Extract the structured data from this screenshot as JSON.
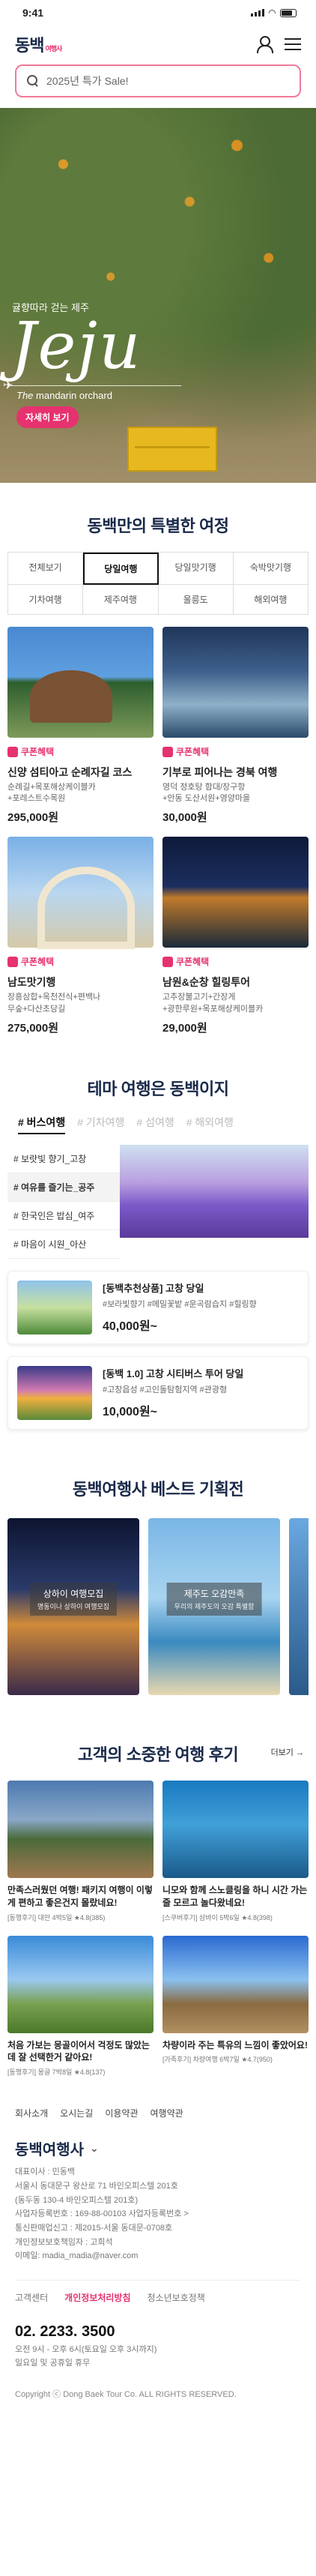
{
  "status": {
    "time": "9:41"
  },
  "header": {
    "logo": "동백",
    "logo_sub": "여행사"
  },
  "search": {
    "placeholder": "2025년 특가 Sale!"
  },
  "hero": {
    "subtitle": "귤향따라 걷는 제주",
    "title": "Jeju",
    "caption_prefix": "The",
    "caption_main": "mandarin orchard",
    "button": "자세히 보기"
  },
  "special": {
    "title": "동백만의 특별한 여정",
    "tabs": [
      "전체보기",
      "당일여행",
      "당일맛기행",
      "숙박맛기행",
      "기차여행",
      "제주여행",
      "울릉도",
      "해외여행"
    ],
    "active_tab": 1,
    "coupon_label": "쿠폰혜택",
    "cards": [
      {
        "title": "신양 섬티아고 순례자길 코스",
        "tags": "순례길+목포해상케이블카\n+포레스트수목원",
        "price": "295,000원"
      },
      {
        "title": "기부로 피어나는 경북 여행",
        "tags": "영덕 정호탕 함대/장구항\n+안동 도산서원+영양마을",
        "price": "30,000원"
      },
      {
        "title": "남도맛기행",
        "tags": "장흥삼합+옥천전식+편백나\n무숲+다산초당길",
        "price": "275,000원"
      },
      {
        "title": "남원&순창 힐링투어",
        "tags": "고추장불고기+간장게\n+광한루원+목포해상케이블카",
        "price": "29,000원"
      }
    ]
  },
  "theme": {
    "title": "테마 여행은 동백이지",
    "tabs": [
      "# 버스여행",
      "# 기차여행",
      "# 섬여행",
      "# 해외여행"
    ],
    "list": [
      "# 보랏빛 향기_고창",
      "# 여유를 즐기는_공주",
      "# 한국인은 밥심_여주",
      "# 마음이 시원_아산"
    ],
    "items": [
      {
        "title": "[동백추천상품] 고창 당일",
        "tags": "#보라빛향기 #메밀꽃밭 #운곡람습지 #힐링향",
        "price": "40,000원~"
      },
      {
        "title": "[동백 1.0] 고창 시티버스 투어 당일",
        "tags": "#고창읍성 #고인돌탐험지역 #관광형",
        "price": "10,000원~"
      }
    ]
  },
  "best": {
    "title": "동백여행사 베스트 기획전",
    "cards": [
      {
        "label": "상하이 여행모집",
        "sub": "명동이나 상하이 여행모집"
      },
      {
        "label": "제주도 오감만족",
        "sub": "우리의 제주도의 오감 특별함"
      }
    ]
  },
  "reviews": {
    "title": "고객의 소중한 여행 후기",
    "more": "더보기",
    "items": [
      {
        "text": "만족스러웠던 여행! 패키지 여행이 이렇게 편하고 좋은건지 몰랐네요!",
        "meta": "[동행후기] 대만 4박5일 ★4.8(385)"
      },
      {
        "text": "니모와 함께 스노클링을 하니 시간 가는줄 모르고 놀다왔네요!",
        "meta": "[스쿠버후기] 삼바이 5박6일 ★4.8(398)"
      },
      {
        "text": "처음 가보는 몽골이어서 걱정도 많았는데 잘 선택한거 같아요!",
        "meta": "[동행후기] 몽골 7박8일 ★4.8(137)"
      },
      {
        "text": "차량이라 주는 특유의 느낌이 좋았어요!",
        "meta": "[가족후기] 차량여행 6박7일 ★4.7(950)"
      }
    ]
  },
  "footer": {
    "links": [
      "회사소개",
      "오시는길",
      "이용약관",
      "여행약관"
    ],
    "logo": "동백여행사",
    "info": [
      "대표이사 : 민동백",
      "서울시 동대문구 왕산로 71 바인오피스텔 201호",
      "(동두동 130-4 바인오피스텔 201호)",
      "사업자등록번호 : 169-88-00103 사업자등록번호 >",
      "통신판매업신고 : 제2015-서울 동대문-0708호",
      "개인정보보호책임자 : 고희석",
      "이메일: madia_madia@naver.com"
    ],
    "policies": [
      "고객센터",
      "개인정보처리방침",
      "청소년보호정책"
    ],
    "phone": "02. 2233. 3500",
    "hours": [
      "오전 9시 - 오후 6시(토요일 오후 3시까지)",
      "일요일 및 공휴일 휴무"
    ],
    "copyright": "Copyright ⓒ Dong Baek Tour Co. ALL RIGHTS RESERVED."
  }
}
